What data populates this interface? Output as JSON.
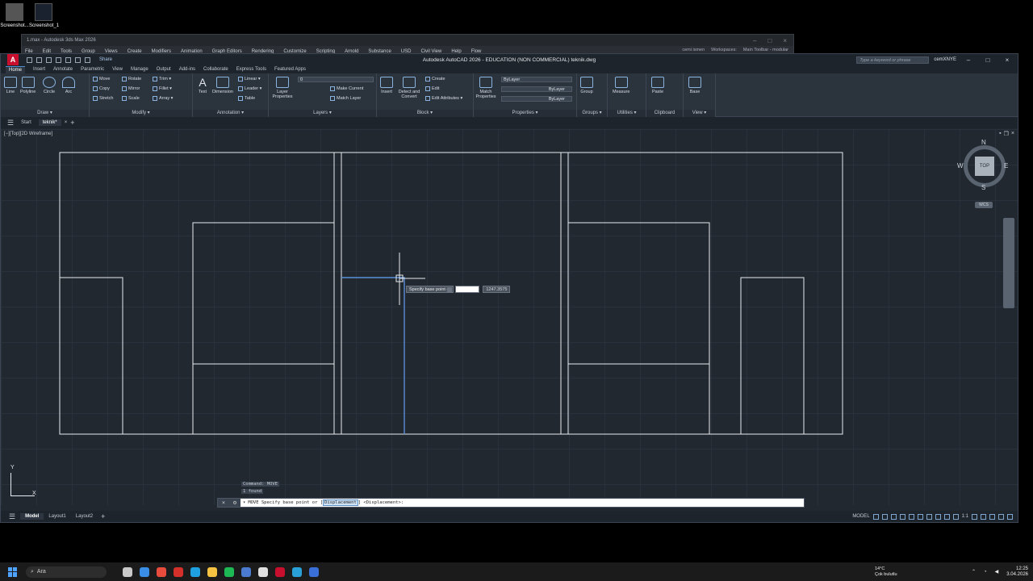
{
  "desktop": {
    "icons": [
      {
        "label": "Screenshot..."
      },
      {
        "label": "Screenshot_1"
      }
    ]
  },
  "max_window": {
    "title": "1.max - Autodesk 3ds Max 2026",
    "menu": [
      "File",
      "Edit",
      "Tools",
      "Group",
      "Views",
      "Create",
      "Modifiers",
      "Animation",
      "Graph Editors",
      "Rendering",
      "Customize",
      "Scripting",
      "Arnold",
      "Substance",
      "USD",
      "Civil View",
      "Help",
      "Flow"
    ],
    "user": "cemi ismen",
    "workspaces_label": "Workspaces:",
    "workspace": "Main Toolbar - modular"
  },
  "acad": {
    "title": "Autodesk AutoCAD 2026 - EDUCATION (NON COMMERCIAL)    teknik.dwg",
    "logo": "A",
    "share": "Share",
    "search_placeholder": "Type a keyword or phrase",
    "user": "cemXNYE",
    "ribbon_tabs": [
      "Home",
      "Insert",
      "Annotate",
      "Parametric",
      "View",
      "Manage",
      "Output",
      "Add-ins",
      "Collaborate",
      "Express Tools",
      "Featured Apps"
    ],
    "active_tab": "Home",
    "panels": {
      "draw": {
        "title": "Draw ▾",
        "line": "Line",
        "polyline": "Polyline",
        "circle": "Circle",
        "arc": "Arc"
      },
      "modify": {
        "title": "Modify ▾",
        "move": "Move",
        "rotate": "Rotate",
        "trim": "Trim ▾",
        "copy": "Copy",
        "mirror": "Mirror",
        "fillet": "Fillet ▾",
        "stretch": "Stretch",
        "scale": "Scale",
        "array": "Array ▾"
      },
      "annotation": {
        "title": "Annotation ▾",
        "text": "Text",
        "dimension": "Dimension",
        "linear": "Linear ▾",
        "leader": "Leader ▾",
        "table": "Table"
      },
      "layers": {
        "title": "Layers ▾",
        "layer_properties": "Layer Properties",
        "layer_value": "0",
        "make_current": "Make Current",
        "match_layer": "Match Layer"
      },
      "block": {
        "title": "Block ▾",
        "insert": "Insert",
        "detect_convert": "Detect and Convert",
        "create": "Create",
        "edit": "Edit",
        "edit_attributes": "Edit Attributes ▾"
      },
      "properties": {
        "title": "Properties ▾",
        "match_properties": "Match Properties",
        "color": "ByLayer",
        "linetype": "ByLayer",
        "lineweight": "ByLayer"
      },
      "groups": {
        "title": "Groups ▾",
        "group": "Group"
      },
      "utilities": {
        "title": "Utilities ▾",
        "measure": "Measure"
      },
      "clipboard": {
        "title": "Clipboard",
        "paste": "Paste"
      },
      "view": {
        "title": "View ▾",
        "base": "Base"
      }
    },
    "file_tabs": [
      "Start",
      "teknik*"
    ],
    "viewport_label": "[−][Top][2D Wireframe]",
    "viewcube": {
      "n": "N",
      "s": "S",
      "e": "E",
      "w": "W",
      "top": "TOP",
      "wcs": "WCS"
    },
    "ucs": {
      "x": "X",
      "y": "Y"
    },
    "tooltip": {
      "prompt": "Specify base point or",
      "value": "1247.3575"
    },
    "command_history": [
      "Command: MOVE",
      "1 found"
    ],
    "command_line": {
      "prefix": "MOVE Specify base point or [",
      "option": "Displacement",
      "suffix": "] <Displacement>:"
    },
    "layout_tabs": [
      "Model",
      "Layout1",
      "Layout2"
    ],
    "status_model": "MODEL",
    "scale": "1:1"
  },
  "taskbar": {
    "search": "Ara",
    "weather_temp": "14°C",
    "weather_desc": "Çok bulutlu",
    "time": "12:25",
    "date": "3.04.2026",
    "app_colors": [
      "#c9c9c9",
      "#3a8ee6",
      "#e84c3d",
      "#d6302a",
      "#1fa0e0",
      "#f5c242",
      "#1db954",
      "#4a7bd0",
      "#e0e0e0",
      "#c8102e",
      "#2aa0d8",
      "#3a6fd8"
    ]
  }
}
